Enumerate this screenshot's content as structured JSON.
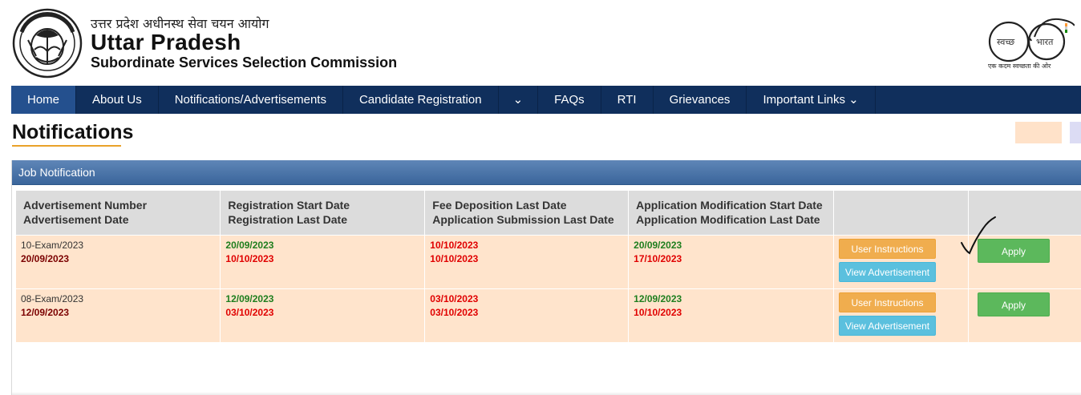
{
  "header": {
    "hindi_title": "उत्तर प्रदेश अधीनस्थ सेवा चयन आयोग",
    "title": "Uttar Pradesh",
    "subtitle": "Subordinate Services Selection Commission",
    "swachh_left": "स्वच्छ",
    "swachh_right": "भारत",
    "swachh_tagline": "एक कदम स्वच्छता की ओर"
  },
  "nav": {
    "items": [
      {
        "label": "Home"
      },
      {
        "label": "About Us"
      },
      {
        "label": "Notifications/Advertisements"
      },
      {
        "label": "Candidate Registration"
      },
      {
        "label": "⌄"
      },
      {
        "label": "FAQs"
      },
      {
        "label": "RTI"
      },
      {
        "label": "Grievances"
      },
      {
        "label": "Important Links ⌄"
      }
    ]
  },
  "page_title": "Notifications",
  "panel": {
    "title": "Job Notification",
    "columns": [
      {
        "line1": "Advertisement Number",
        "line2": "Advertisement Date"
      },
      {
        "line1": "Registration Start Date",
        "line2": "Registration Last Date"
      },
      {
        "line1": "Fee Deposition Last Date",
        "line2": "Application Submission Last Date"
      },
      {
        "line1": "Application Modification Start Date",
        "line2": "Application Modification Last Date"
      },
      {
        "line1": "",
        "line2": ""
      },
      {
        "line1": "",
        "line2": ""
      }
    ],
    "rows": [
      {
        "adv_number": "10-Exam/2023",
        "adv_date": "20/09/2023",
        "reg_start": "20/09/2023",
        "reg_last": "10/10/2023",
        "fee_last": "10/10/2023",
        "submission_last": "10/10/2023",
        "mod_start": "20/09/2023",
        "mod_last": "17/10/2023",
        "instructions_label": "User Instructions",
        "view_label": "View Advertisement",
        "apply_label": "Apply"
      },
      {
        "adv_number": "08-Exam/2023",
        "adv_date": "12/09/2023",
        "reg_start": "12/09/2023",
        "reg_last": "03/10/2023",
        "fee_last": "03/10/2023",
        "submission_last": "03/10/2023",
        "mod_start": "12/09/2023",
        "mod_last": "10/10/2023",
        "instructions_label": "User Instructions",
        "view_label": "View Advertisement",
        "apply_label": "Apply"
      }
    ]
  }
}
